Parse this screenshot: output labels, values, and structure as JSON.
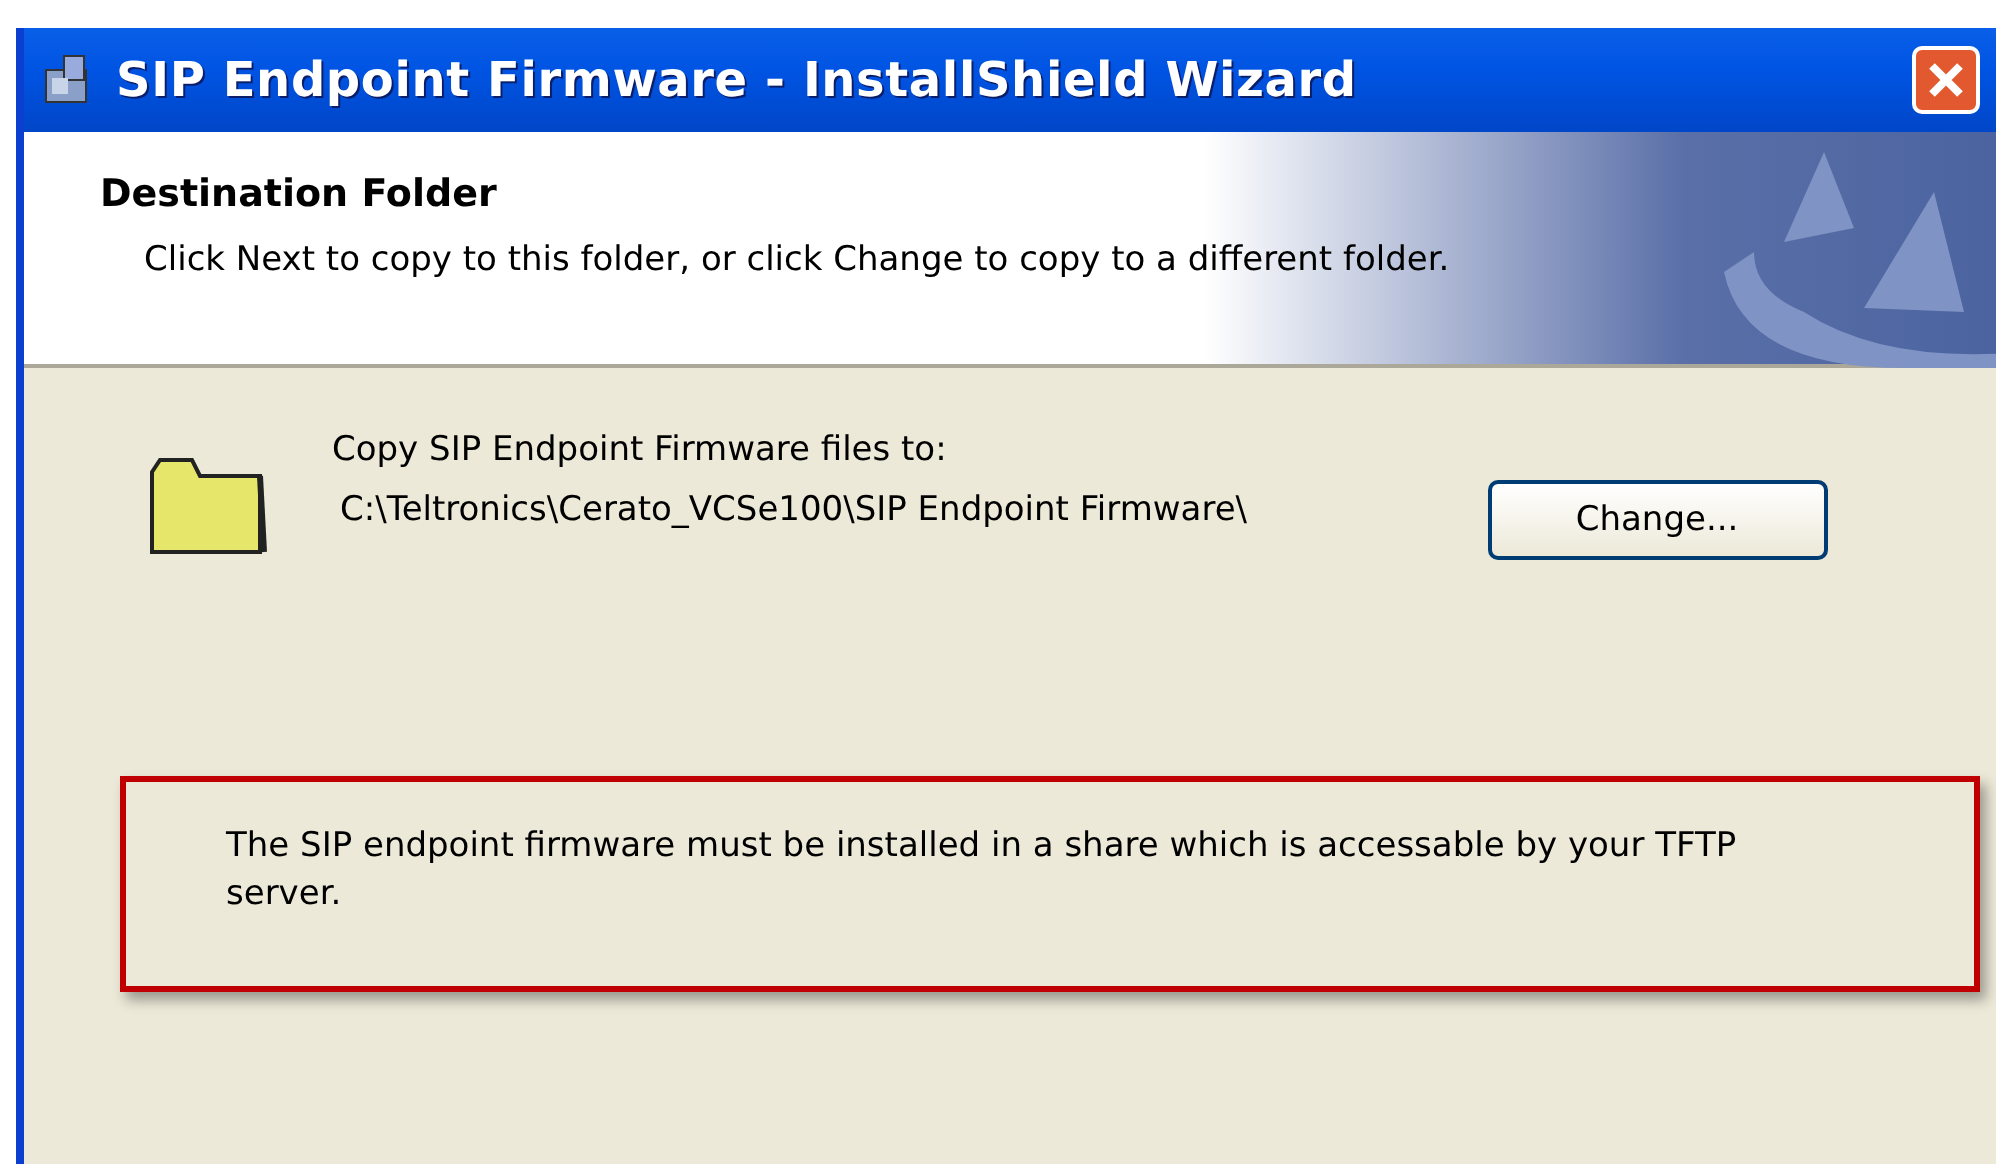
{
  "window": {
    "title": "SIP Endpoint Firmware - InstallShield Wizard"
  },
  "header": {
    "title": "Destination Folder",
    "subtitle": "Click Next to copy to this folder, or click Change to copy to a different folder."
  },
  "destination": {
    "label": "Copy SIP Endpoint Firmware files to:",
    "path": "C:\\Teltronics\\Cerato_VCSe100\\SIP Endpoint Firmware\\",
    "button": "Change..."
  },
  "note": {
    "text": "The SIP endpoint firmware must be installed in a share which is accessable by your TFTP server."
  }
}
